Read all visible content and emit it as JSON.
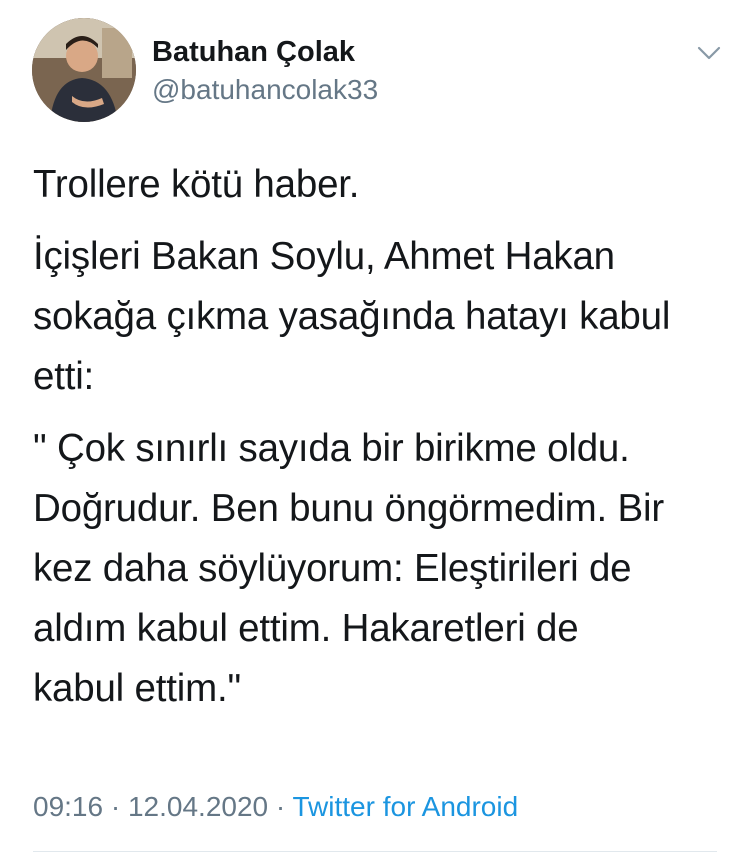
{
  "user": {
    "display_name": "Batuhan Çolak",
    "handle": "@batuhancolak33"
  },
  "tweet": {
    "paragraphs": [
      [
        "Trollere kötü haber."
      ],
      [
        "İçişleri Bakan Soylu, Ahmet Hakan",
        "sokağa çıkma yasağında hatayı kabul",
        "etti:"
      ],
      [
        "\" Çok sınırlı sayıda bir birikme oldu.",
        "Doğrudur. Ben bunu öngörmedim. Bir",
        "kez daha söylüyorum: Eleştirileri de",
        "aldım kabul ettim. Hakaretleri de",
        "kabul ettim.\""
      ]
    ],
    "time": "09:16",
    "separator": "·",
    "date": "12.04.2020",
    "source": "Twitter for Android"
  },
  "icons": {
    "avatar": "avatar-photo",
    "caret": "chevron-down-icon"
  },
  "colors": {
    "text": "#14171a",
    "secondary": "#657786",
    "link": "#1b95e0",
    "divider": "#e1e8ed"
  }
}
